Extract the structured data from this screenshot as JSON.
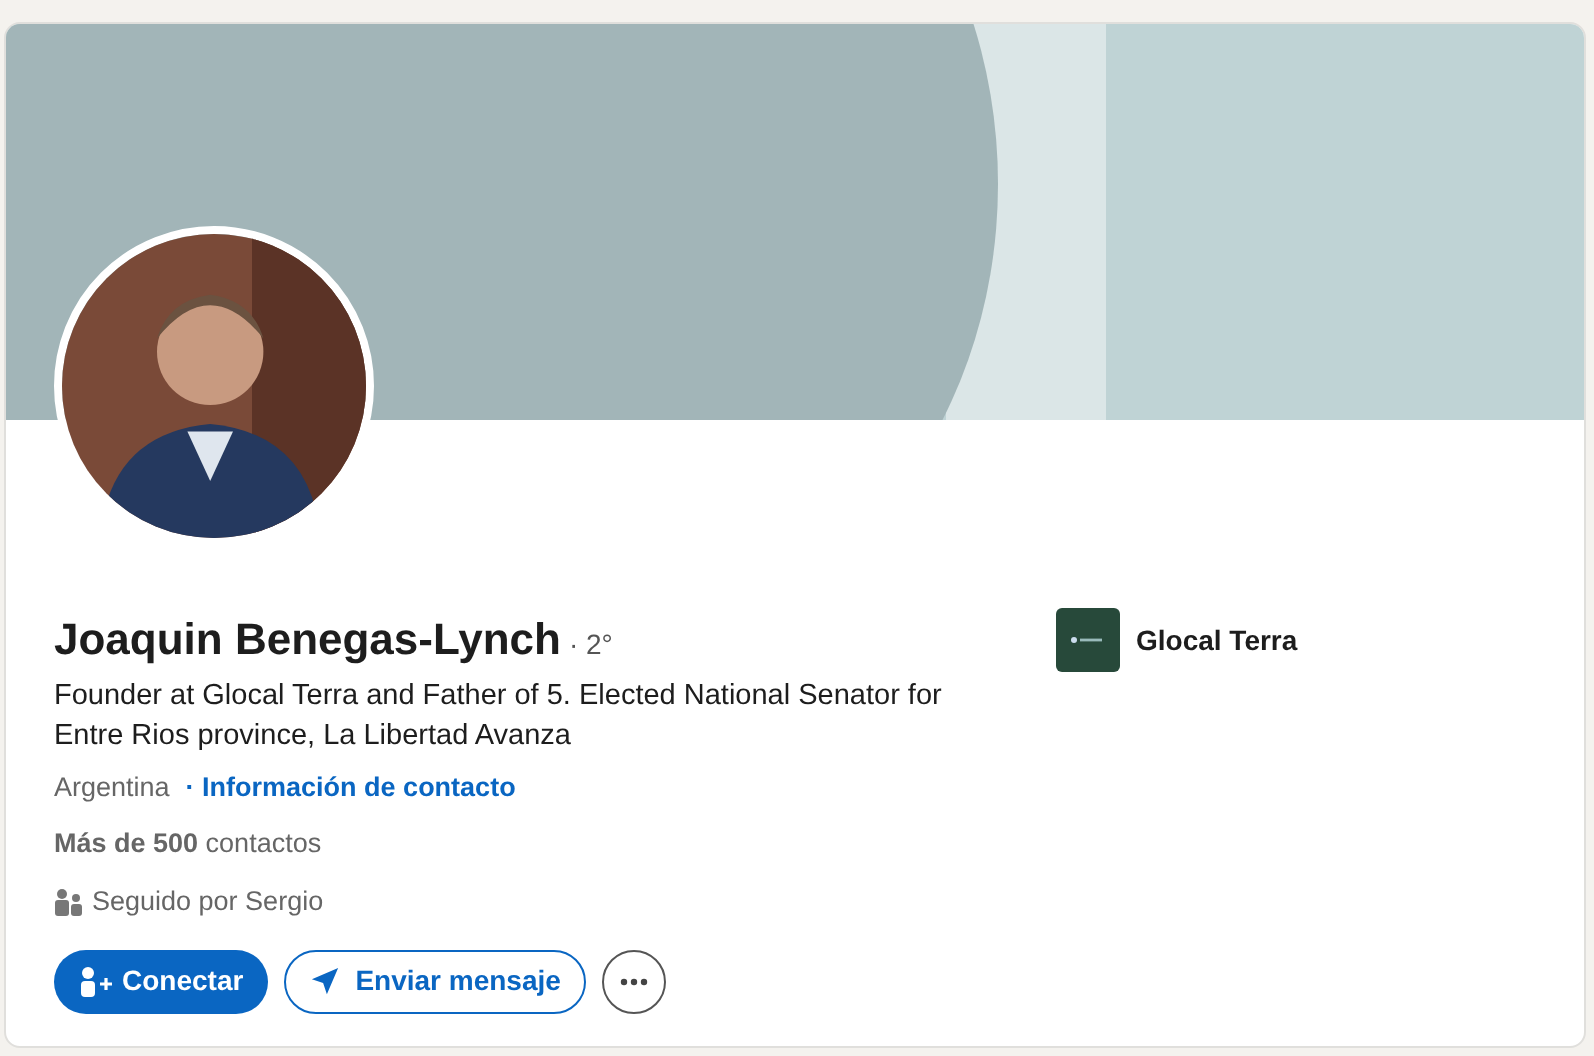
{
  "profile": {
    "name": "Joaquin Benegas-Lynch",
    "degree": "· 2°",
    "headline": "Founder at Glocal Terra and Father of 5. Elected National Senator for Entre Rios province, La Libertad Avanza",
    "location": "Argentina",
    "contact_link": "· Información de contacto",
    "connections": "**Más de 500** contactos",
    "followed_by": "Seguido por Sergio"
  },
  "actions": [
    {
      "kind": "primary",
      "label": "Conectar"
    },
    {
      "kind": "secondary",
      "label": "Enviar mensaje"
    },
    {
      "kind": "more"
    }
  ],
  "company": {
    "name": "Glocal Terra"
  }
}
